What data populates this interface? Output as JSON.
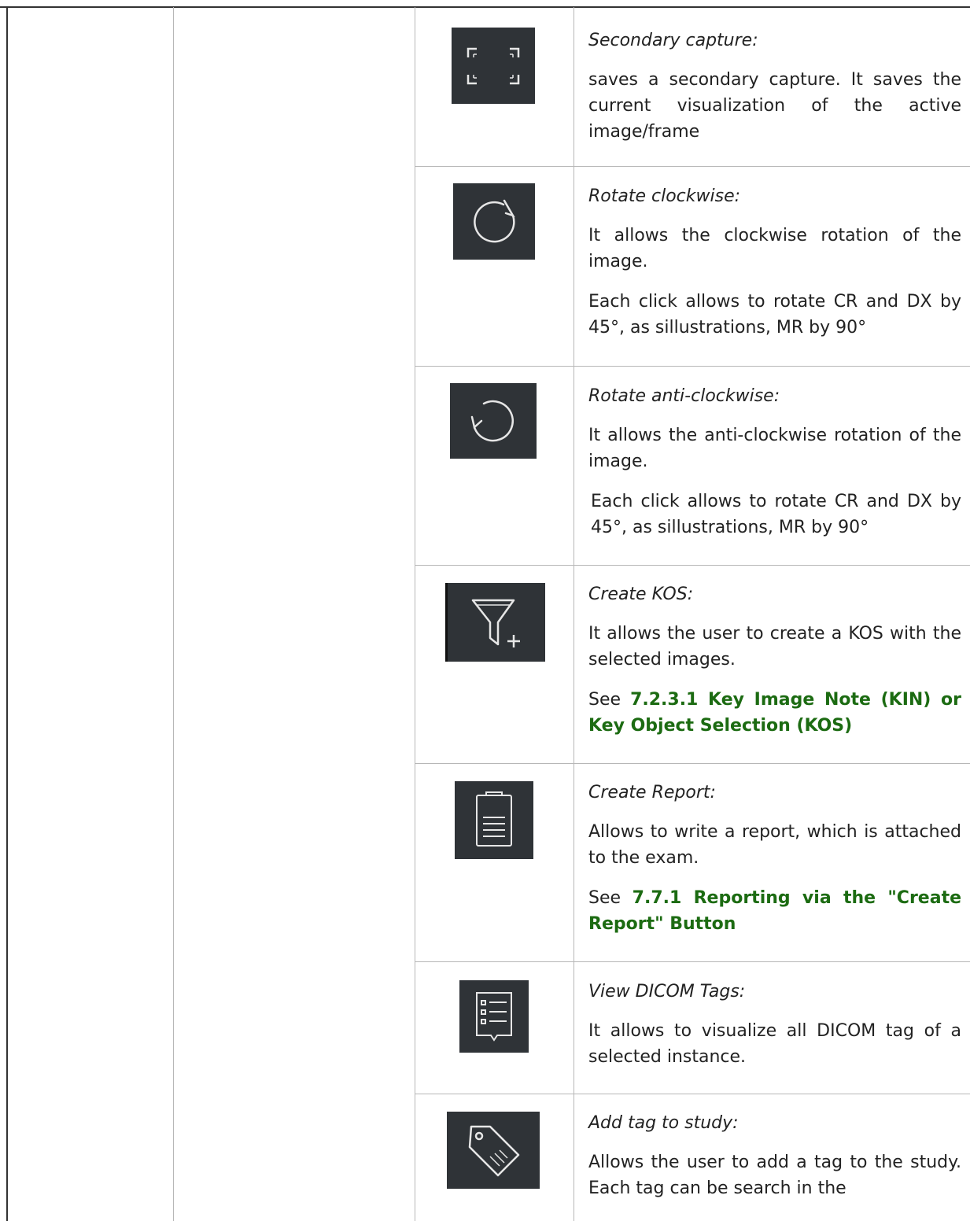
{
  "rows": [
    {
      "icon": "secondary-capture-icon",
      "title": "Secondary capture:",
      "paras": [
        {
          "text": "saves a secondary capture. It saves the current visualization of the active image/frame"
        }
      ]
    },
    {
      "icon": "rotate-clockwise-icon",
      "title": "Rotate clockwise:",
      "paras": [
        {
          "text": "It allows the clockwise rotation of the image."
        },
        {
          "text": "Each click allows to rotate CR and DX by 45°, as sillustrations, MR by 90°"
        }
      ]
    },
    {
      "icon": "rotate-anticlockwise-icon",
      "title": "Rotate anti-clockwise:",
      "paras": [
        {
          "text": "It allows the anti-clockwise rotation of the image."
        },
        {
          "text": "Each click allows to rotate CR and DX by 45°, as sillustrations, MR by 90°"
        }
      ]
    },
    {
      "icon": "create-kos-filter-icon",
      "title": "Create KOS:",
      "paras": [
        {
          "text": "It allows the user to create a KOS with the selected images."
        },
        {
          "prefix": "See ",
          "link": "7.2.3.1 Key Image Note (KIN) or Key Object Selection (KOS)"
        }
      ]
    },
    {
      "icon": "clipboard-report-icon",
      "title": "Create Report:",
      "paras": [
        {
          "text": "Allows to write a report, which is attached to the exam."
        },
        {
          "prefix": "See ",
          "link": "7.7.1 Reporting via the \"Create Report\" Button"
        }
      ]
    },
    {
      "icon": "dicom-tags-list-icon",
      "title": "View DICOM Tags:",
      "paras": [
        {
          "text": "It allows to visualize all DICOM tag of a selected instance."
        }
      ]
    },
    {
      "icon": "tag-label-icon",
      "title": "Add tag to study:",
      "paras": [
        {
          "text": "Allows the user to add a tag to the study. Each tag can be search in the"
        }
      ]
    }
  ]
}
